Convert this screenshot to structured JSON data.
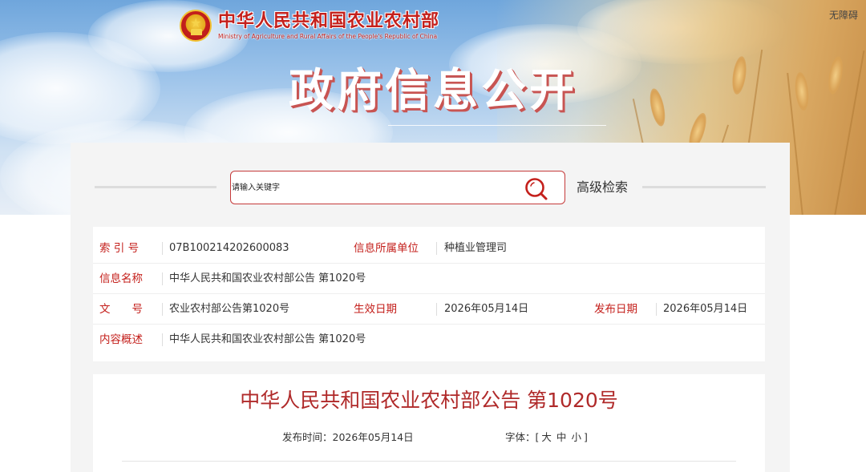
{
  "header": {
    "logo_cn": "中华人民共和国农业农村部",
    "logo_en": "Ministry of Agriculture and Rural Affairs of the People's Republic of China",
    "accessibility": "无障碍",
    "banner_title": "政府信息公开"
  },
  "search": {
    "placeholder": "请输入关键字",
    "advanced_label": "高级检索"
  },
  "info": {
    "index_label": "索 引 号",
    "index_value": "07B100214202600083",
    "unit_label": "信息所属单位",
    "unit_value": "种植业管理司",
    "name_label": "信息名称",
    "name_value": "中华人民共和国农业农村部公告 第1020号",
    "doc_label": "文　　号",
    "doc_value": "农业农村部公告第1020号",
    "effective_label": "生效日期",
    "effective_value": "2026年05月14日",
    "publish_label": "发布日期",
    "publish_value": "2026年05月14日",
    "summary_label": "内容概述",
    "summary_value": "中华人民共和国农业农村部公告 第1020号"
  },
  "article": {
    "title": "中华人民共和国农业农村部公告 第1020号",
    "publish_time_label": "发布时间：",
    "publish_time_value": "2026年05月14日",
    "font_label": "字体：",
    "font_open": "[",
    "font_large": "大",
    "font_medium": "中",
    "font_small": "小",
    "font_close": "]"
  },
  "colors": {
    "brand_red": "#c4201c",
    "title_red": "#b02a2a",
    "search_border": "#c53a3a"
  }
}
